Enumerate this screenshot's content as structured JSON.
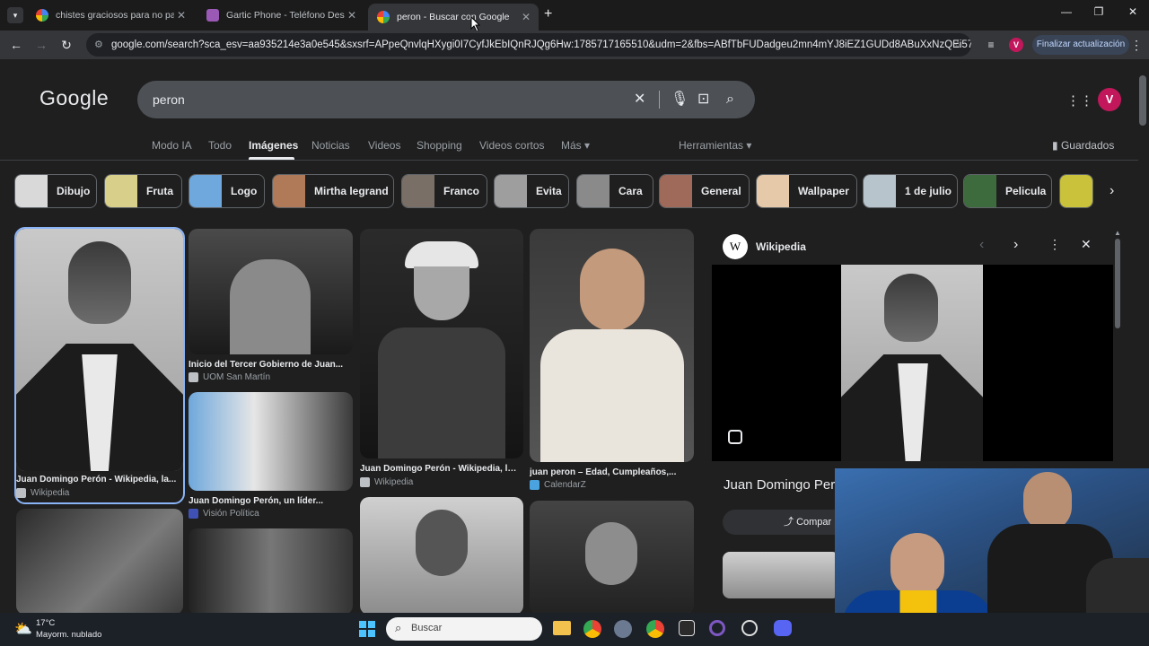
{
  "browser": {
    "tabs": [
      {
        "title": "chistes graciosos para no parar",
        "active": false
      },
      {
        "title": "Gartic Phone - Teléfono Descon",
        "active": false
      },
      {
        "title": "peron - Buscar con Google",
        "active": true
      }
    ],
    "url": "google.com/search?sca_esv=aa935214e3a0e545&sxsrf=APpeQnvlqHXygi0I7CyfJkEbIQnRJQg6Hw:1785717165510&udm=2&fbs=ABfTbFUDadgeu2mn4mYJ8iEZ1GUDd8ABuXxNzQEi57S...",
    "update_button": "Finalizar actualización",
    "profile_initial": "V"
  },
  "google": {
    "logo": "Google",
    "query": "peron",
    "profile_initial": "V",
    "nav_tabs": [
      "Modo IA",
      "Todo",
      "Imágenes",
      "Noticias",
      "Videos",
      "Shopping",
      "Videos cortos",
      "Más"
    ],
    "selected_tab": "Imágenes",
    "tools": "Herramientas",
    "saved": "Guardados"
  },
  "chips": [
    "Dibujo",
    "Fruta",
    "Logo",
    "Mirtha legrand",
    "Franco",
    "Evita",
    "Cara",
    "General",
    "Wallpaper",
    "1 de julio",
    "Pelicula"
  ],
  "results": [
    {
      "title": "Juan Domingo Perón - Wikipedia, la...",
      "source": "Wikipedia"
    },
    {
      "title": "Inicio del Tercer Gobierno de Juan...",
      "source": "UOM San Martín"
    },
    {
      "title": "Juan Domingo Perón, un líder...",
      "source": "Visión Política"
    },
    {
      "title": "Juan Domingo Perón - Wikipedia, la...",
      "source": "Wikipedia"
    },
    {
      "title": "juan peron – Edad, Cumpleaños,...",
      "source": "CalendarZ"
    }
  ],
  "panel": {
    "site": "Wikipedia",
    "title": "Juan Domingo Perón",
    "share": "Compar"
  },
  "taskbar": {
    "temp": "17°C",
    "weather": "Mayorm. nublado",
    "search_placeholder": "Buscar"
  },
  "colors": {
    "accent": "#8ab4f8",
    "avatar": "#c2185b",
    "update_bg": "#394457"
  }
}
